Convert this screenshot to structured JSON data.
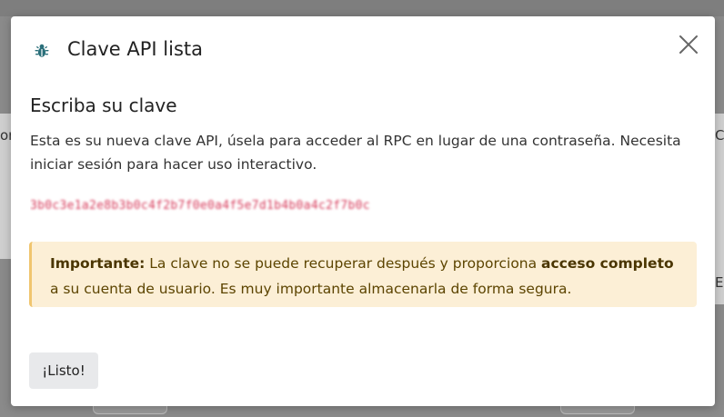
{
  "modal": {
    "title": "Clave API lista",
    "section_title": "Escriba su clave",
    "description": "Esta es su nueva clave API, úsela para acceder al RPC en lugar de una contraseña. Necesita iniciar sesión para hacer uso interactivo.",
    "api_key": "3b0c3e1a2e8b3b0c4f2b7f0e0a4f5e7d1b4b0a4c2f7b0c",
    "warning": {
      "label": "Importante:",
      "text_before": " La clave no se puede recuperar después y proporciona ",
      "emphasis": "acceso completo",
      "text_after": " a su cuenta de usuario. Es muy importante almacenarla de forma segura."
    },
    "done_label": "¡Listo!",
    "icons": {
      "header": "bug-icon",
      "close": "close-icon"
    },
    "colors": {
      "icon": "#2a6f7a",
      "key": "#d63a5a",
      "warning_bg": "#fcefd6",
      "warning_border": "#f0c56f",
      "warning_text": "#5c4400"
    }
  },
  "background": {
    "left_fragment": "or",
    "right_fragment_1": "C",
    "right_fragment_2": "E"
  }
}
